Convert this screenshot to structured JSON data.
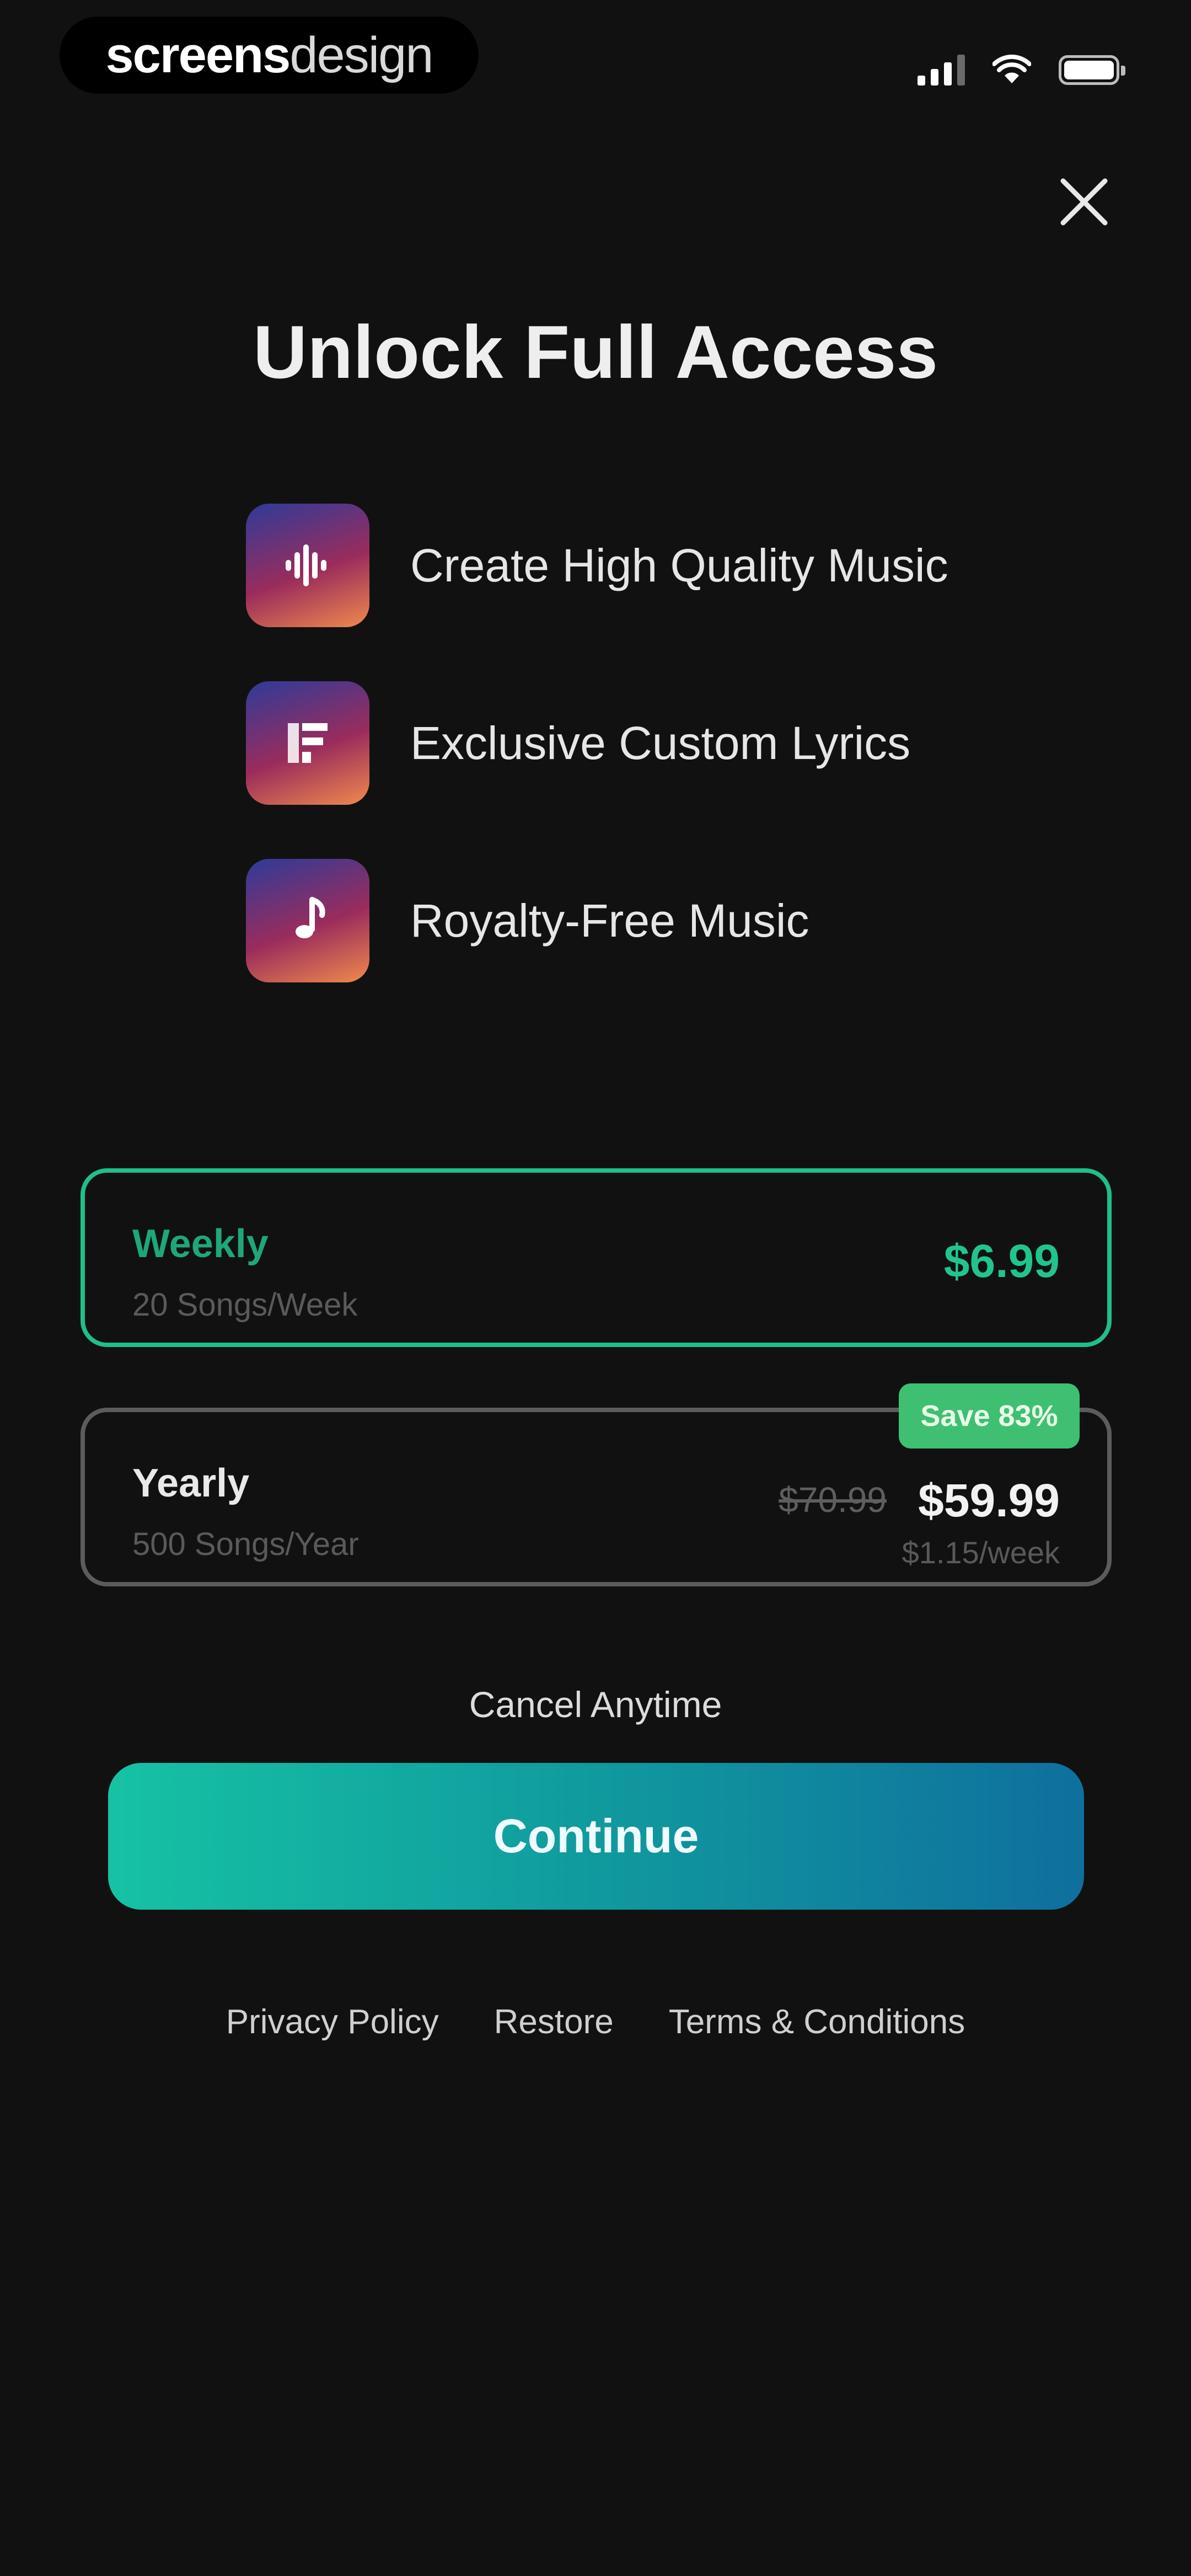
{
  "status_bar": {
    "brand_strong": "screens",
    "brand_light": "design",
    "signal_icon": "signal-icon",
    "wifi_icon": "wifi-icon",
    "battery_icon": "battery-icon"
  },
  "close": {
    "icon": "close-icon"
  },
  "title": "Unlock Full Access",
  "features": [
    {
      "icon": "waveform-icon",
      "label": "Create High Quality Music"
    },
    {
      "icon": "lyrics-icon",
      "label": "Exclusive Custom Lyrics"
    },
    {
      "icon": "music-note-icon",
      "label": "Royalty-Free Music"
    }
  ],
  "plans": {
    "weekly": {
      "name": "Weekly",
      "sub": "20 Songs/Week",
      "price": "$6.99",
      "selected": true
    },
    "yearly": {
      "name": "Yearly",
      "sub": "500 Songs/Year",
      "original_price": "$70.99",
      "price": "$59.99",
      "per_week": "$1.15/week",
      "badge": "Save 83%"
    }
  },
  "cancel_anytime": "Cancel Anytime",
  "continue_label": "Continue",
  "footer": {
    "privacy": "Privacy Policy",
    "restore": "Restore",
    "terms": "Terms & Conditions"
  },
  "colors": {
    "background": "#111111",
    "accent_green": "#1fbf86",
    "badge_green": "#3fbf72",
    "button_gradient_start": "#16c2a4",
    "button_gradient_end": "#0f6f9e"
  }
}
